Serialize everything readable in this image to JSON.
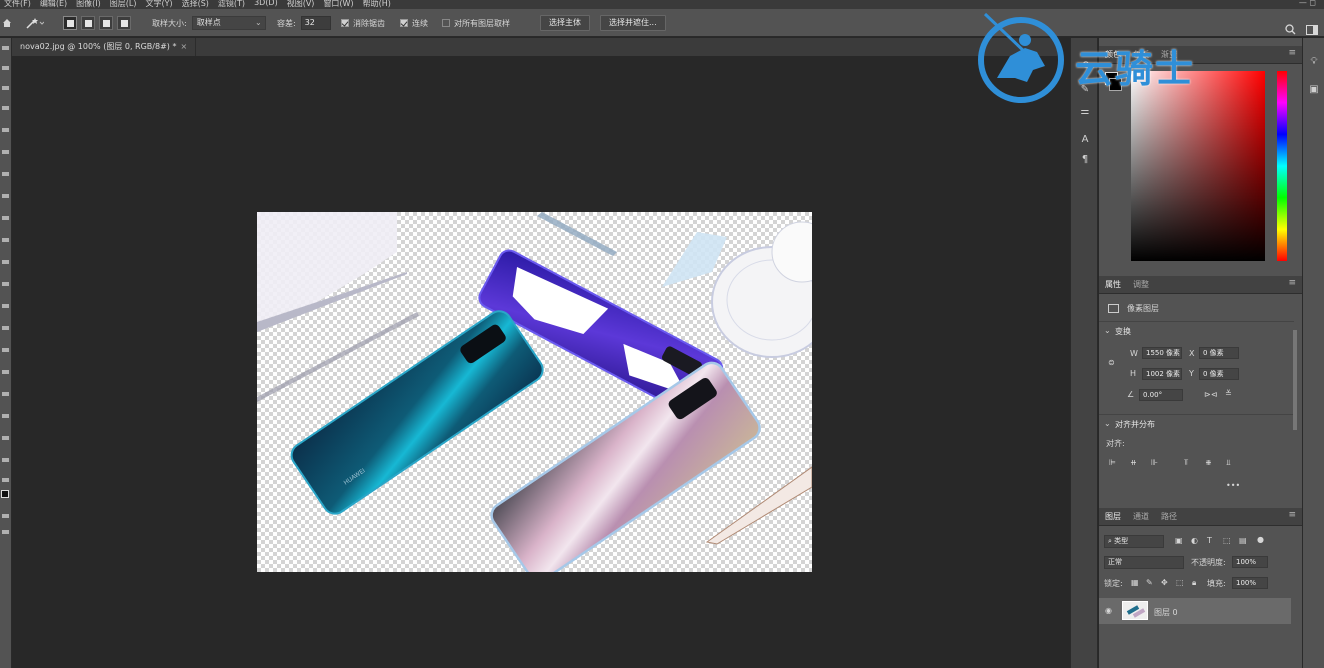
{
  "menubar": {
    "items": [
      "文件(F)",
      "编辑(E)",
      "图像(I)",
      "图层(L)",
      "文字(Y)",
      "选择(S)",
      "滤镜(T)",
      "3D(D)",
      "视图(V)",
      "窗口(W)",
      "帮助(H)"
    ],
    "window_controls": "—  ◻"
  },
  "options": {
    "sample_size_label": "取样大小:",
    "sample_size_value": "取样点",
    "tolerance_label": "容差:",
    "tolerance_value": "32",
    "antialias_label": "消除锯齿",
    "antialias_checked": true,
    "contiguous_label": "连续",
    "contiguous_checked": true,
    "sample_all_label": "对所有图层取样",
    "sample_all_checked": false,
    "select_subject_label": "选择主体",
    "select_mask_label": "选择并遮住..."
  },
  "document": {
    "tab_title": "nova02.jpg @ 100% (图层 0, RGB/8#) *",
    "close": "×"
  },
  "watermark": {
    "text": "云骑士"
  },
  "color_panel": {
    "tabs": [
      "颜色",
      "色板",
      "渐变"
    ]
  },
  "properties_panel": {
    "tabs": [
      "属性",
      "调整"
    ],
    "layer_type": "像素图层",
    "transform_title": "变换",
    "w_label": "W",
    "w_value": "1550 像素",
    "x_label": "X",
    "x_value": "0 像素",
    "h_label": "H",
    "h_value": "1002 像素",
    "y_label": "Y",
    "y_value": "0 像素",
    "angle_value": "0.00°",
    "align_title": "对齐并分布",
    "align_label": "对齐:",
    "more": "•••"
  },
  "layers_panel": {
    "tabs": [
      "图层",
      "通道",
      "路径"
    ],
    "filter_label": "类型",
    "blend_mode": "正常",
    "opacity_label": "不透明度:",
    "opacity_value": "100%",
    "lock_label": "锁定:",
    "fill_label": "填充:",
    "fill_value": "100%",
    "layers": [
      {
        "name": "图层 0",
        "visible": true
      }
    ]
  },
  "colors": {
    "accent": "#2f8fd8",
    "panel_bg": "#535353",
    "workspace": "#282828"
  }
}
